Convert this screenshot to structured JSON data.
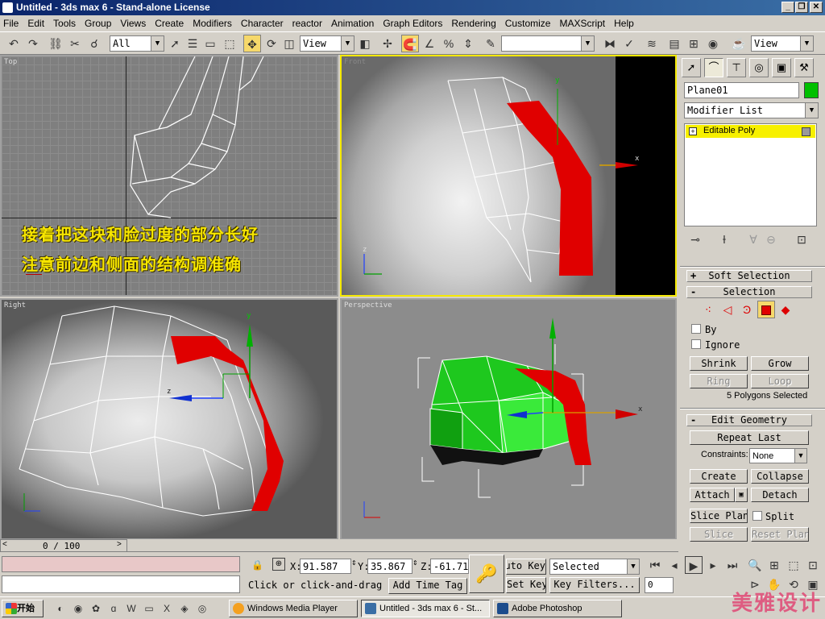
{
  "window": {
    "title": "Untitled - 3ds max 6 - Stand-alone License",
    "minimize": "_",
    "maximize": "❐",
    "close": "✕"
  },
  "menu": [
    "File",
    "Edit",
    "Tools",
    "Group",
    "Views",
    "Create",
    "Modifiers",
    "Character",
    "reactor",
    "Animation",
    "Graph Editors",
    "Rendering",
    "Customize",
    "MAXScript",
    "Help"
  ],
  "toolbar": {
    "selection_filter": "All",
    "ref_coord": "View",
    "named_selection": "",
    "ref_coord_2": "View"
  },
  "viewports": {
    "top": {
      "label": "Top"
    },
    "front": {
      "label": "Front",
      "axis_y": "y",
      "axis_x": "x",
      "axis_z": "z"
    },
    "right": {
      "label": "Right",
      "axis_y": "y",
      "axis_z": "z"
    },
    "perspective": {
      "label": "Perspective",
      "axis_x": "x"
    }
  },
  "overlay_text": {
    "line1": "接着把这块和脸过度的部分长好",
    "line2": "注意前边和侧面的结构调准确"
  },
  "command_panel": {
    "object_name": "Plane01",
    "object_color": "#00c000",
    "modifier_list": "Modifier List",
    "stack_item": "Editable Poly",
    "soft_selection": "Soft Selection",
    "selection": "Selection",
    "by_vertex": "By",
    "ignore_backfacing": "Ignore",
    "shrink": "Shrink",
    "grow": "Grow",
    "ring": "Ring",
    "loop": "Loop",
    "selection_count": "5 Polygons Selected",
    "edit_geometry": "Edit Geometry",
    "repeat_last": "Repeat Last",
    "constraints_label": "Constraints:",
    "constraints_value": "None",
    "create": "Create",
    "collapse": "Collapse",
    "attach": "Attach",
    "detach": "Detach",
    "slice_plane": "Slice Plane",
    "split": "Split",
    "slice": "Slice",
    "reset_plane": "Reset Plane"
  },
  "status": {
    "time_slider": "0 / 100",
    "x_label": "X:",
    "x_value": "91.587",
    "y_label": "Y:",
    "y_value": "35.867",
    "z_label": "Z:",
    "z_value": "-61.71",
    "prompt": "Click or click-and-drag",
    "add_time_tag": "Add Time Tag",
    "auto_key": "Auto Key",
    "set_key": "Set Key",
    "key_mode": "Selected",
    "key_filters": "Key Filters...",
    "frame": "0"
  },
  "taskbar": {
    "start": "开始",
    "tasks": [
      "Windows Media Player",
      "Untitled - 3ds max 6 - St...",
      "Adobe Photoshop"
    ],
    "watermark": "美雅设计"
  }
}
